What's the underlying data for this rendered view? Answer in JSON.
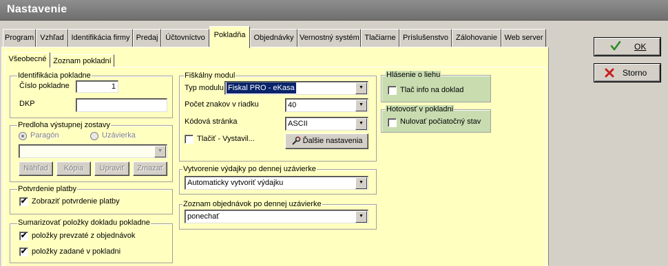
{
  "window": {
    "title": "Nastavenie"
  },
  "tabs": [
    {
      "label": "Program"
    },
    {
      "label": "Vzhľad"
    },
    {
      "label": "Identifikácia firmy"
    },
    {
      "label": "Predaj"
    },
    {
      "label": "Účtovníctvo"
    },
    {
      "label": "Pokladňa"
    },
    {
      "label": "Objednávky"
    },
    {
      "label": "Vernostný systém"
    },
    {
      "label": "Tlačiarne"
    },
    {
      "label": "Príslušenstvo"
    },
    {
      "label": "Zálohovanie"
    },
    {
      "label": "Web server"
    }
  ],
  "active_tab": "Pokladňa",
  "subtabs": [
    {
      "label": "Všeobecné"
    },
    {
      "label": "Zoznam pokladní"
    }
  ],
  "identifikacia": {
    "title": "Identifikácia pokladne",
    "cislo_label": "Číslo pokladne",
    "cislo_value": "1",
    "dkp_label": "DKP",
    "dkp_value": ""
  },
  "predloha": {
    "title": "Predloha výstupnej zostavy",
    "radio_paragon": "Paragón",
    "radio_uzavierka": "Uzávierka",
    "select_value": "",
    "btn_nahlad": "Náhľad",
    "btn_kopia": "Kópia",
    "btn_upravit": "Upraviť",
    "btn_zmazat": "Zmazať"
  },
  "potvrdenie": {
    "title": "Potvrdenie platby",
    "cb_label": "Zobraziť potvrdenie platby",
    "checked": "✔"
  },
  "sumarizovat": {
    "title": "Sumarizovať položky dokladu pokladne",
    "cb1_label": "položky prevzaté z objednávok",
    "cb2_label": "položky zadané v pokladni",
    "checked": "✔"
  },
  "fiskalny": {
    "title": "Fiškálny modul",
    "typ_label": "Typ modulu",
    "typ_value": "Fiskal PRO - eKasa",
    "pocet_label": "Počet znakov v riadku",
    "pocet_value": "40",
    "kodova_label": "Kódová stránka",
    "kodova_value": "ASCII",
    "tlacit_label": "Tlačiť - Vystavil...",
    "dalsie_label": "Ďalšie nastavenia"
  },
  "vytvorenie": {
    "title": "Vytvorenie výdajky po dennej uzávierke",
    "value": "Automaticky vytvoriť výdajku"
  },
  "zoznam_obj": {
    "title": "Zoznam objednávok po dennej uzávierke",
    "value": "ponechať"
  },
  "hlasenie": {
    "title": "Hlásenie o liehu",
    "cb_label": "Tlač info na doklad"
  },
  "hotovost": {
    "title": "Hotovosť v pokladni",
    "cb_label": "Nulovať počiatočný stav"
  },
  "buttons": {
    "ok_label": "OK",
    "storno_label": "Storno"
  },
  "colors": {
    "panel": "#ffffc0",
    "group_green": "#c8dcb0",
    "titlebar": "#7f7f7f",
    "selection": "#0a246a",
    "ok_check": "#2a8a2a",
    "storno_x": "#c81e1e"
  }
}
